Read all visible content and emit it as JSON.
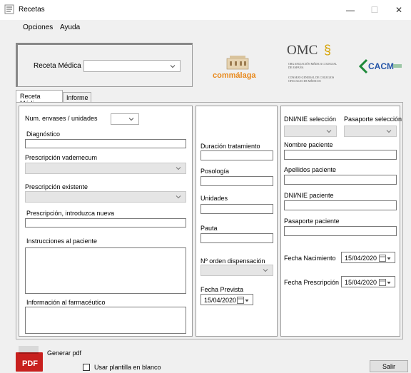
{
  "window": {
    "title": "Recetas",
    "minimize": "—",
    "maximize": "☐",
    "close": "✕"
  },
  "menu": [
    {
      "label": "Opciones"
    },
    {
      "label": "Ayuda"
    }
  ],
  "header": {
    "receta_label": "Receta Médica",
    "receta_select_value": "",
    "logos": {
      "commalaga": "commálaga",
      "omc_title": "OMC",
      "omc_sub1": "ORGANIZACIÓN MÉDICA COLEGIAL DE ESPAÑA",
      "omc_sub2": "CONSEJO GENERAL DE COLEGIOS OFICIALES DE MÉDICOS",
      "cacm": "CACM"
    }
  },
  "tabs": [
    {
      "label": "Receta Médica",
      "active": true
    },
    {
      "label": "Informe",
      "active": false
    }
  ],
  "left": {
    "envases_label": "Num. envases / unidades",
    "diagnostico_label": "Diagnóstico",
    "vademecum_label": "Prescripción vademecum",
    "existente_label": "Prescripción existente",
    "nueva_label": "Prescripción, introduzca nueva",
    "instrucciones_label": "Instrucciones al paciente",
    "farmaceutico_label": "Información al farmacéutico"
  },
  "middle": {
    "duracion_label": "Duración tratamiento",
    "posologia_label": "Posología",
    "unidades_label": "Unidades",
    "pauta_label": "Pauta",
    "orden_label": "Nº orden dispensación",
    "fecha_prevista_label": "Fecha Prevista",
    "fecha_prevista_value": "15/04/2020"
  },
  "right": {
    "dni_sel_label": "DNI/NIE selección",
    "pasaporte_sel_label": "Pasaporte selección",
    "nombre_label": "Nombre paciente",
    "apellidos_label": "Apellidos paciente",
    "dni_label": "DNI/NIE paciente",
    "pasaporte_label": "Pasaporte paciente",
    "nacimiento_label": "Fecha Nacimiento",
    "nacimiento_value": "15/04/2020",
    "prescripcion_label": "Fecha Prescripción",
    "prescripcion_value": "15/04/2020"
  },
  "footer": {
    "pdf_icon_text": "PDF",
    "generar_label": "Generar pdf",
    "plantilla_label": "Usar plantilla en blanco",
    "salir_label": "Salir"
  },
  "colors": {
    "pdf_red": "#c8201e",
    "omc_gold": "#d6a200",
    "cacm_green": "#1e8a3a",
    "cacm_blue": "#2757a8",
    "commalaga_orange": "#e8891c"
  }
}
